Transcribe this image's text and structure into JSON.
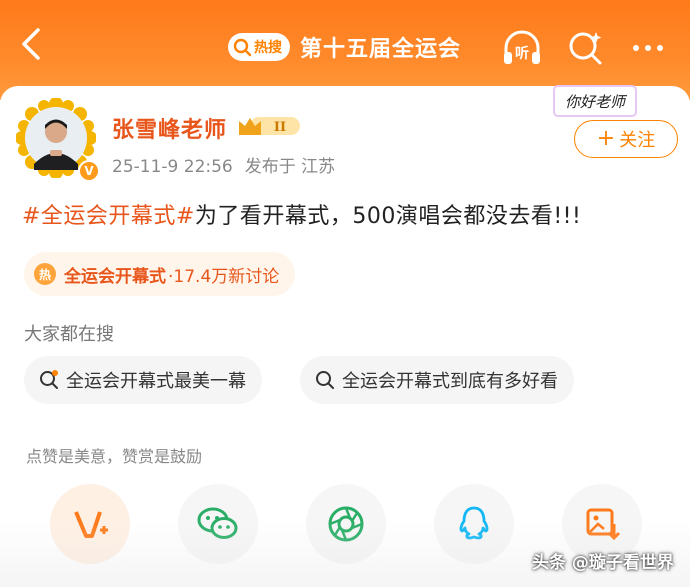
{
  "header": {
    "hot_badge_label": "热搜",
    "title": "第十五届全运会",
    "listen_label": "听"
  },
  "post": {
    "username": "张雪峰老师",
    "rank_badge": "II",
    "vip_mark": "V",
    "date": "25-11-9 22:56",
    "location": "发布于 江苏",
    "sticker_text": "你好老师",
    "follow_label": "关注",
    "follow_plus": "+",
    "hashtag": "#全运会开幕式#",
    "body_text": "为了看开幕式，500演唱会都没去看!!!",
    "topic": {
      "icon_text": "热",
      "name": "全运会开幕式",
      "count": "·17.4万新讨论"
    },
    "search_section_label": "大家都在搜",
    "searches": [
      {
        "text": "全运会开幕式最美一幕",
        "icon": "hot-search-icon"
      },
      {
        "text": "全运会开幕式到底有多好看",
        "icon": "search-icon"
      }
    ],
    "praise_text": "点赞是美意，赞赏是鼓励",
    "actions": [
      {
        "icon": "reward-v-icon"
      },
      {
        "icon": "wechat-icon"
      },
      {
        "icon": "moments-icon"
      },
      {
        "icon": "qq-icon"
      },
      {
        "icon": "save-image-icon"
      }
    ]
  },
  "watermark": "头条 @璇子看世界",
  "colors": {
    "header_orange": "#ff8200",
    "accent_red_orange": "#e8561c",
    "wechat_green": "#2aae67",
    "qq_blue": "#12b7f5"
  }
}
